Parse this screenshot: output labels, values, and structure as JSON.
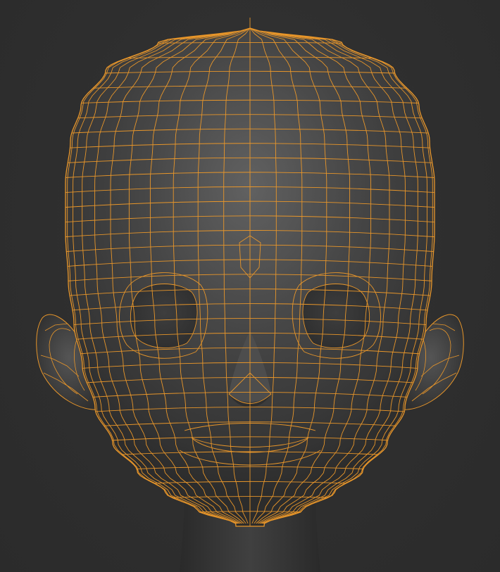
{
  "scene": {
    "subject": "",
    "colors": {
      "background": "#2f2f2f",
      "mesh_base": "#3a3a3a",
      "mesh_highlight": "#5e5e5e",
      "wire": "#e8962a"
    }
  }
}
